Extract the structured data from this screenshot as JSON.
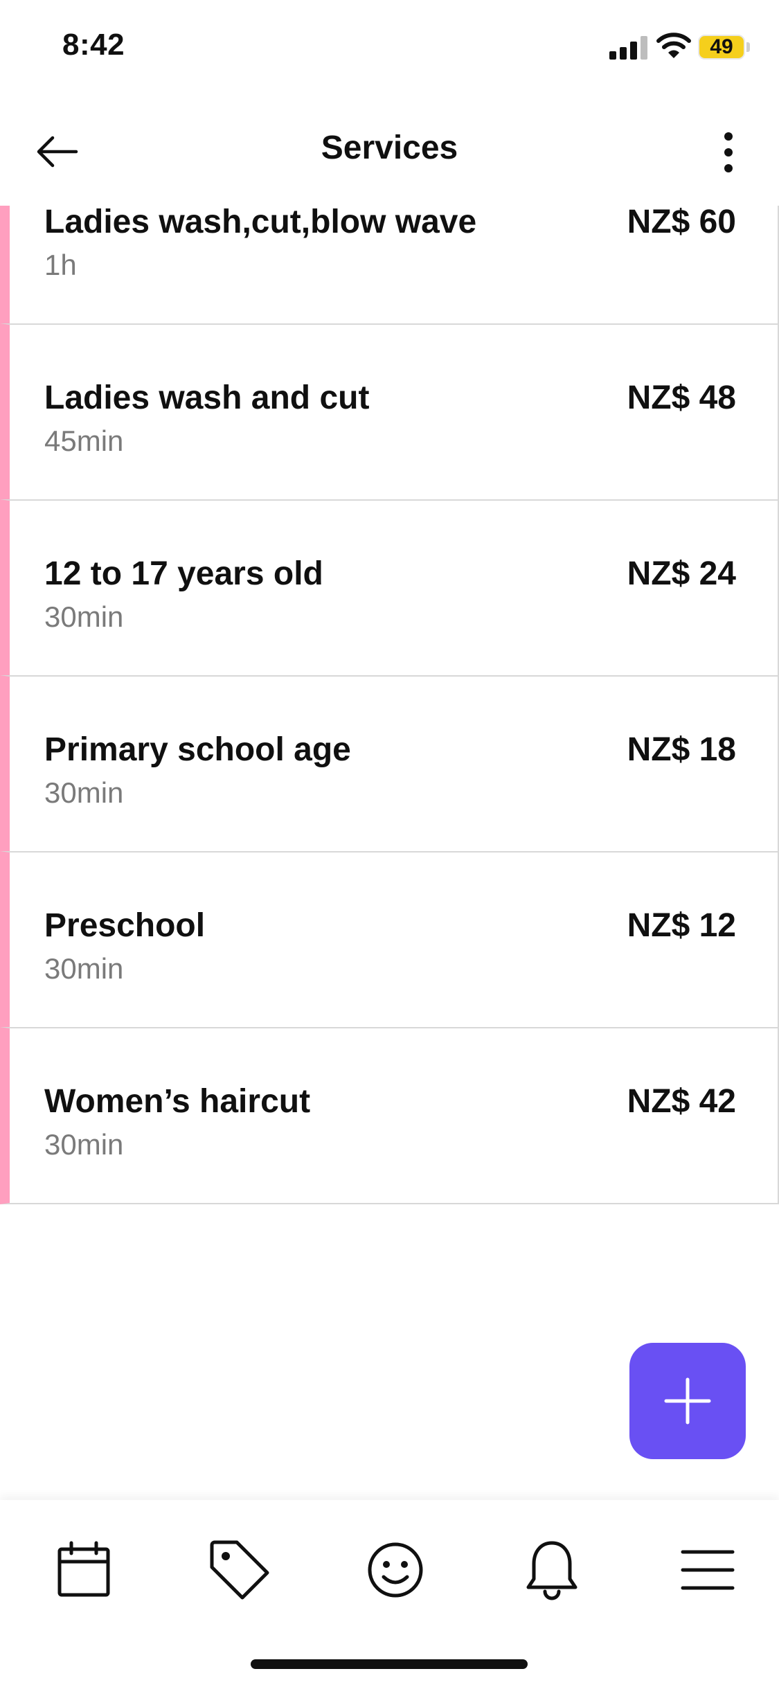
{
  "status_bar": {
    "time": "8:42",
    "battery_level": "49",
    "battery_color": "#f5cf1c",
    "icons": [
      "signal-icon",
      "wifi-icon",
      "battery-icon"
    ]
  },
  "header": {
    "title": "Services",
    "back_icon": "arrow-left-icon",
    "more_icon": "more-vertical-icon"
  },
  "services": [
    {
      "name": "Ladies wash,cut,blow wave",
      "duration": "1h",
      "price": "NZ$ 60"
    },
    {
      "name": "Ladies wash and cut",
      "duration": "45min",
      "price": "NZ$ 48"
    },
    {
      "name": "12 to 17 years old",
      "duration": "30min",
      "price": "NZ$ 24"
    },
    {
      "name": "Primary school age",
      "duration": "30min",
      "price": "NZ$ 18"
    },
    {
      "name": "Preschool",
      "duration": "30min",
      "price": "NZ$ 12"
    },
    {
      "name": "Women’s haircut",
      "duration": "30min",
      "price": "NZ$ 42"
    }
  ],
  "service_accent_color": "#ff9fbf",
  "add_button": {
    "icon": "plus-icon",
    "color": "#6950f3"
  },
  "tab_bar": {
    "tabs": [
      {
        "icon": "calendar-icon"
      },
      {
        "icon": "tag-icon"
      },
      {
        "icon": "smiley-icon"
      },
      {
        "icon": "bell-icon"
      },
      {
        "icon": "menu-icon"
      }
    ]
  }
}
